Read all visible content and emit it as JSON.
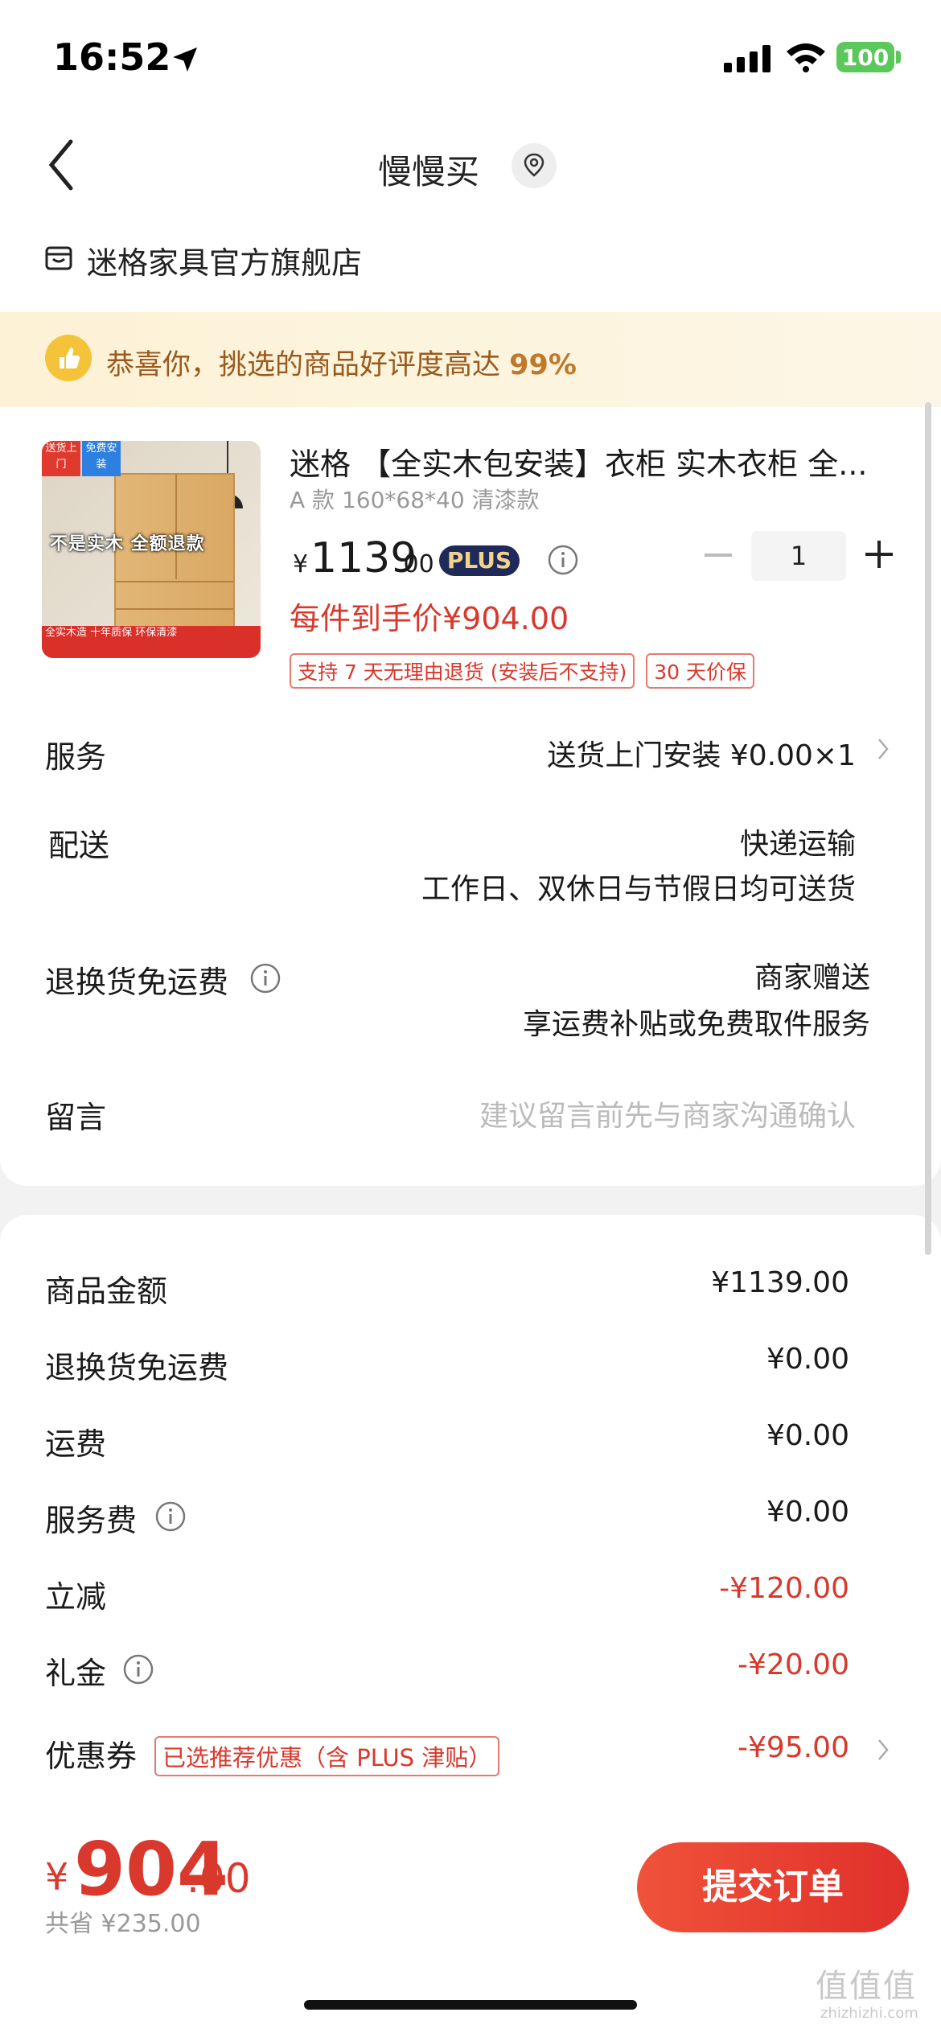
{
  "status_bar": {
    "time": "16:52",
    "battery": "100"
  },
  "header": {
    "title": "慢慢买"
  },
  "store": {
    "name": "迷格家具官方旗舰店"
  },
  "banner": {
    "text_before": "恭喜你，挑选的商品好评度高达 ",
    "highlight": "99%"
  },
  "product": {
    "image_tags": [
      "送货上门",
      "免费安装"
    ],
    "image_slogan": "不是实木 全额退款",
    "image_footer": "全实木造 十年质保 环保清漆",
    "title": "迷格 【全实木包安装】衣柜 实木衣柜 全...",
    "spec": "A 款 160*68*40 清漆款",
    "price_symbol": "¥",
    "price_int": "1139",
    "price_dec": ".00",
    "plus_label": "PLUS",
    "quantity": "1",
    "final_price": "每件到手价¥904.00",
    "tags": [
      "支持 7 天无理由退货 (安装后不支持)",
      "30 天价保"
    ]
  },
  "rows": {
    "service": {
      "label": "服务",
      "value": "送货上门安装  ¥0.00×1"
    },
    "delivery": {
      "label": "配送",
      "value1": "快递运输",
      "value2": "工作日、双休日与节假日均可送货"
    },
    "return": {
      "label": "退换货免运费",
      "value1": "商家赠送",
      "value2": "享运费补贴或免费取件服务"
    },
    "message": {
      "label": "留言",
      "placeholder": "建议留言前先与商家沟通确认"
    }
  },
  "summary": [
    {
      "label": "商品金额",
      "value": "¥1139.00",
      "color": "#1a1a1a"
    },
    {
      "label": "退换货免运费",
      "value": "¥0.00",
      "color": "#1a1a1a"
    },
    {
      "label": "运费",
      "value": "¥0.00",
      "color": "#1a1a1a"
    },
    {
      "label": "服务费",
      "value": "¥0.00",
      "color": "#1a1a1a"
    },
    {
      "label": "立减",
      "value": "-¥120.00",
      "color": "#d9382c"
    },
    {
      "label": "礼金",
      "value": "-¥20.00",
      "color": "#d9382c"
    },
    {
      "label": "优惠券",
      "tag": "已选推荐优惠（含 PLUS 津贴）",
      "value": "-¥95.00",
      "color": "#d9382c"
    }
  ],
  "footer": {
    "total_symbol": "¥",
    "total_int": "904",
    "total_dec": ".00",
    "saved": "共省 ¥235.00",
    "submit": "提交订单"
  },
  "watermark": {
    "main": "值值值",
    "sub": "zhizhizhi.com"
  },
  "colors": {
    "accent_red": "#d9382c",
    "banner_text": "#9a5a1e",
    "plus_bg": "#1f2a5a"
  }
}
